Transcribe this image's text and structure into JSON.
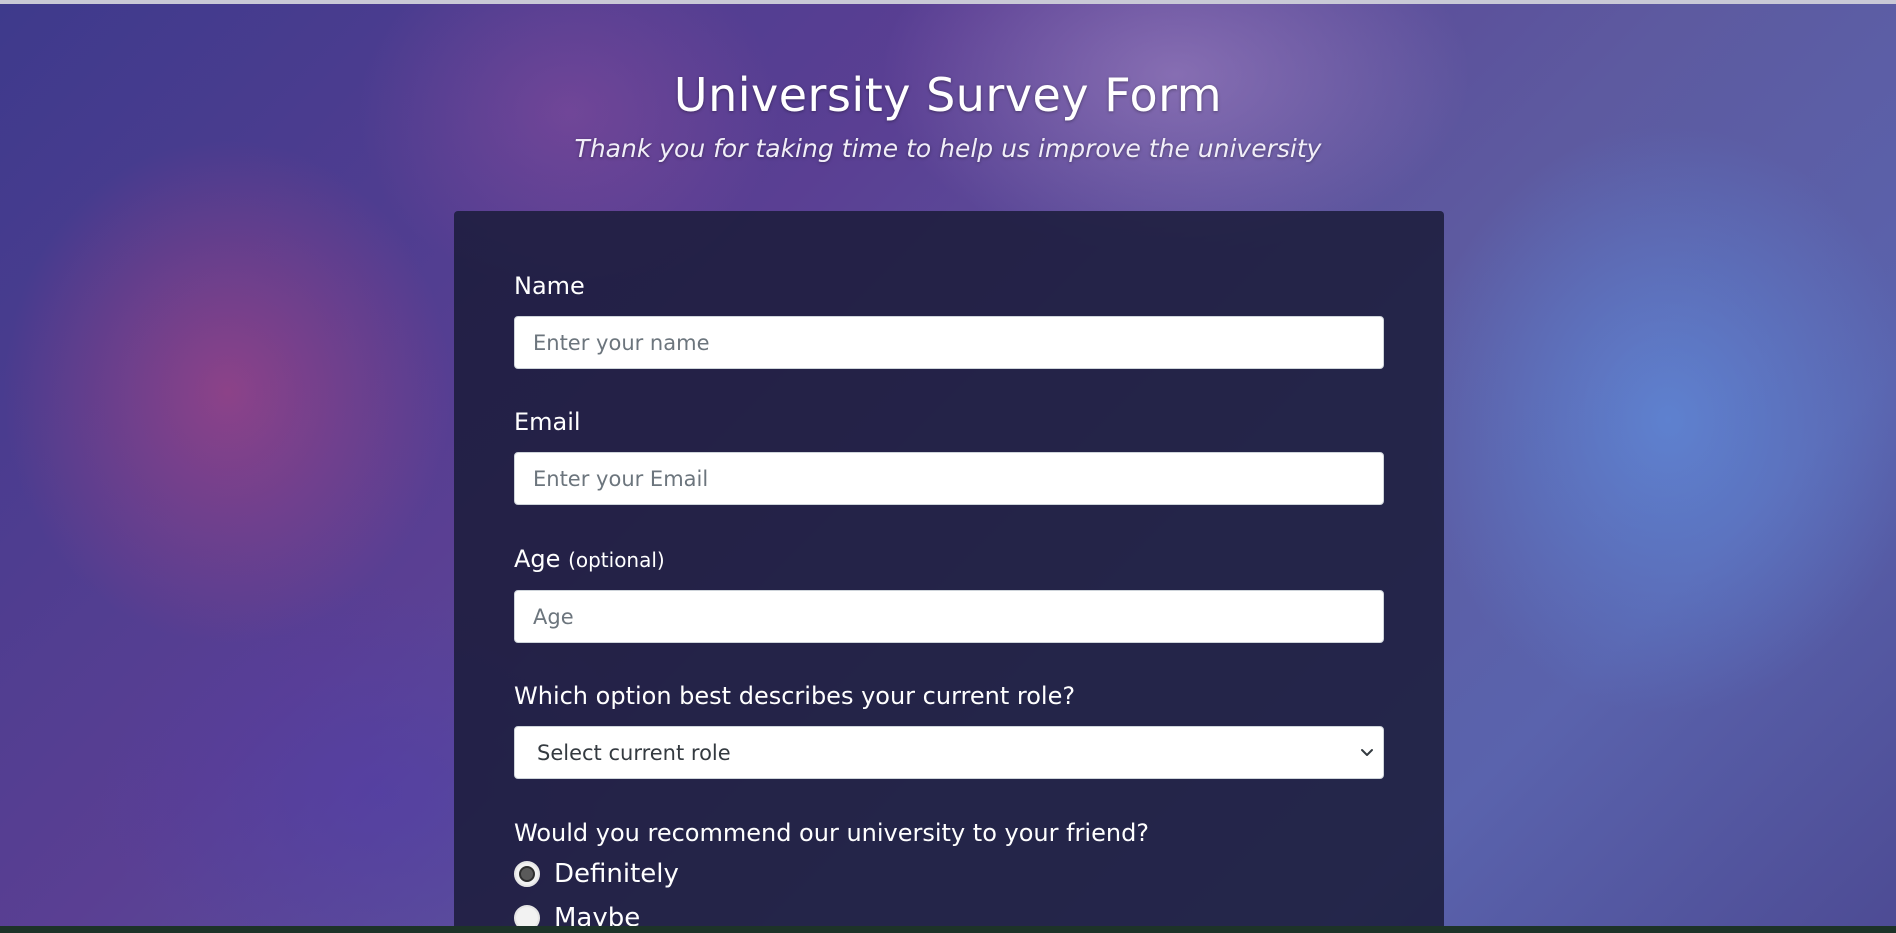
{
  "header": {
    "title": "University Survey Form",
    "subtitle": "Thank you for taking time to help us improve the university"
  },
  "form": {
    "name": {
      "label": "Name",
      "placeholder": "Enter your name",
      "value": ""
    },
    "email": {
      "label": "Email",
      "placeholder": "Enter your Email",
      "value": ""
    },
    "age": {
      "label": "Age",
      "label_suffix": "(optional)",
      "placeholder": "Age",
      "value": ""
    },
    "role": {
      "label": "Which option best describes your current role?",
      "selected": "Select current role",
      "icon": "chevron-down-icon"
    },
    "recommend": {
      "label": "Would you recommend our university to your friend?",
      "options": [
        {
          "label": "Definitely",
          "checked": true
        },
        {
          "label": "Maybe",
          "checked": false
        }
      ]
    }
  },
  "colors": {
    "card_background": "#1b1c3a",
    "text": "#ffffff",
    "input_background": "#ffffff"
  }
}
